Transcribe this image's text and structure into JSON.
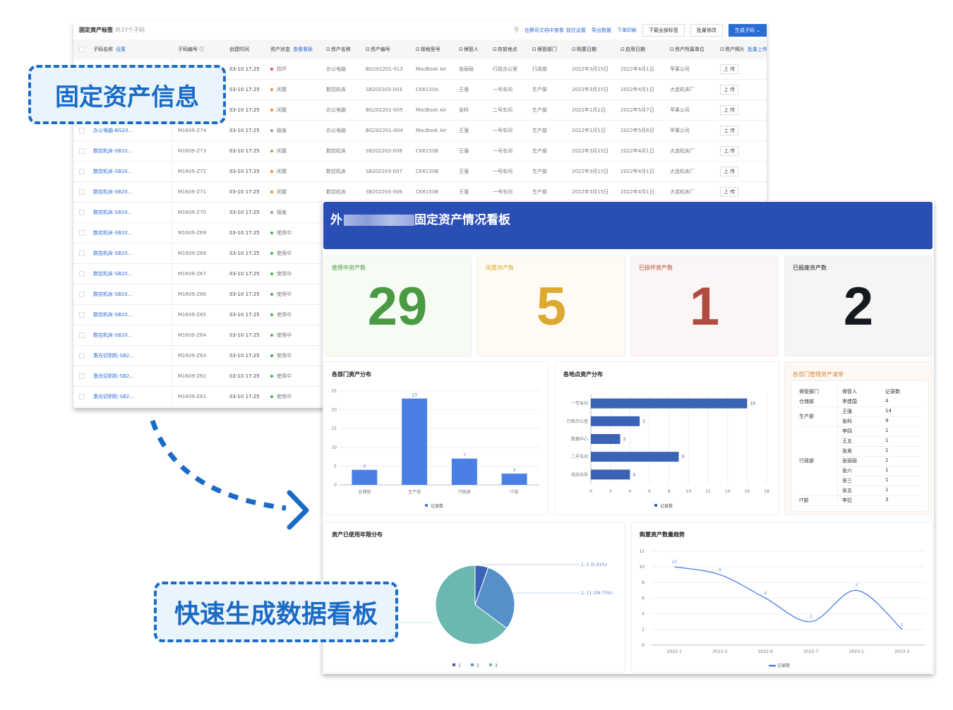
{
  "table": {
    "title": "固定资产标签",
    "count_text": "共37个子码",
    "actions": {
      "view_in_docs": "在腾讯文档中查看",
      "go_settings": "前往设置",
      "export": "导出数据",
      "print": "下单印刷",
      "download_all": "下载全部标签",
      "batch_edit": "批量修改",
      "generate": "生成子码"
    },
    "columns": [
      {
        "label": "子码名称",
        "link": "设置"
      },
      {
        "label": "子码编号 ⓘ"
      },
      {
        "label": "创建时间"
      },
      {
        "label": "资产状态",
        "link": "查看看板"
      },
      {
        "label": "资产名称"
      },
      {
        "label": "资产编号"
      },
      {
        "label": "规格型号"
      },
      {
        "label": "保管人"
      },
      {
        "label": "存放地点"
      },
      {
        "label": "保管部门"
      },
      {
        "label": "购置日期"
      },
      {
        "label": "启用日期"
      },
      {
        "label": "资产所属单位"
      },
      {
        "label": "资产照片",
        "link": "批量上传"
      }
    ],
    "upload_label": "上 传",
    "status_colors": {
      "损坏": "#e5484d",
      "闲置": "#f08a24",
      "报废": "#999999",
      "使用中": "#3cb44b"
    },
    "rows": [
      [
        "",
        "",
        "03-10 17:25",
        "损坏",
        "办公电脑",
        "BG202201-013",
        "MacBook Air",
        "张丽丽",
        "行政办公室",
        "行政部",
        "2022年3月15日",
        "2022年4月1日",
        "苹果公司"
      ],
      [
        "",
        "",
        "03-10 17:25",
        "闲置",
        "数控机床",
        "SB202203-003",
        "CK6150A",
        "王强",
        "一号车间",
        "生产部",
        "2022年3月15日",
        "2022年4月1日",
        "大连机床厂"
      ],
      [
        "",
        "",
        "03-10 17:25",
        "闲置",
        "办公电脑",
        "BG202201-005",
        "MacBook Air",
        "张科",
        "二号车间",
        "生产部",
        "2022年1月1日",
        "2022年5月7日",
        "苹果公司"
      ],
      [
        "办公电脑-BG20...",
        "M1609-Z74",
        "03-10 17:25",
        "报废",
        "办公电脑",
        "BG202201-004",
        "MacBook Air",
        "王强",
        "一号车间",
        "生产部",
        "2022年1月1日",
        "2022年5月6日",
        "苹果公司"
      ],
      [
        "数控机床-SB20...",
        "M1609-Z73",
        "03-10 17:25",
        "闲置",
        "数控机床",
        "SB202203-008",
        "CK6150B",
        "王强",
        "一号车间",
        "生产部",
        "2022年3月15日",
        "2022年4月1日",
        "大连机床厂"
      ],
      [
        "数控机床-SB20...",
        "M1609-Z72",
        "03-10 17:25",
        "闲置",
        "数控机床",
        "SB202203-007",
        "CK6150B",
        "王强",
        "一号车间",
        "生产部",
        "2022年3月15日",
        "2022年4月1日",
        "大连机床厂"
      ],
      [
        "数控机床-SB20...",
        "M1609-Z71",
        "03-10 17:25",
        "闲置",
        "数控机床",
        "SB202203-006",
        "CK6150B",
        "王强",
        "一号车间",
        "生产部",
        "2022年3月15日",
        "2022年4月1日",
        "大连机床厂"
      ],
      [
        "数控机床-SB20...",
        "M1609-Z70",
        "03-10 17:25",
        "报废"
      ],
      [
        "数控机床-SB20...",
        "M1609-Z69",
        "03-10 17:25",
        "使用中"
      ],
      [
        "数控机床-SB20...",
        "M1609-Z68",
        "03-10 17:25",
        "使用中"
      ],
      [
        "数控机床-SB20...",
        "M1609-Z67",
        "03-10 17:25",
        "使用中"
      ],
      [
        "数控机床-SB20...",
        "M1609-Z66",
        "03-10 17:25",
        "使用中"
      ],
      [
        "数控机床-SB20...",
        "M1609-Z65",
        "03-10 17:25",
        "使用中"
      ],
      [
        "数控机床-SB20...",
        "M1609-Z64",
        "03-10 17:25",
        "使用中"
      ],
      [
        "激光切割机-SB2...",
        "M1609-Z63",
        "03-10 17:25",
        "使用中"
      ],
      [
        "激光切割机-SB2...",
        "M1609-Z62",
        "03-10 17:25",
        "使用中"
      ],
      [
        "激光切割机-SB2...",
        "M1609-Z61",
        "03-10 17:25",
        "使用中"
      ]
    ],
    "upload_rows": 7
  },
  "dashboard": {
    "title_prefix": "外",
    "title": "固定资产情况看板",
    "banner_color": "#2a4fb4",
    "cards": [
      {
        "label": "使用中资产数",
        "value": "29",
        "color": "#4a9a44",
        "bg": "#f6fbf4"
      },
      {
        "label": "闲置资产数",
        "value": "5",
        "color": "#dcaa30",
        "bg": "#fffbf4"
      },
      {
        "label": "已损坏资产数",
        "value": "1",
        "color": "#b14a3f",
        "bg": "#fcf5f5"
      },
      {
        "label": "已报废资产数",
        "value": "2",
        "color": "#15181c",
        "bg": "#f5f5f5"
      }
    ],
    "manager_list": {
      "title": "各部门管理资产清单",
      "headers": [
        "保管部门",
        "保管人",
        "记录数"
      ],
      "groups": [
        {
          "dept": "仓储部",
          "rows": [
            [
              "李建国",
              "4"
            ]
          ]
        },
        {
          "dept": "生产部",
          "rows": [
            [
              "王强",
              "14"
            ],
            [
              "张科",
              "9"
            ]
          ]
        },
        {
          "dept": "行政部",
          "rows": [
            [
              "李四",
              "1"
            ],
            [
              "王五",
              "1"
            ],
            [
              "张发",
              "1"
            ],
            [
              "张丽丽",
              "1"
            ],
            [
              "张六",
              "1"
            ],
            [
              "张三",
              "1"
            ],
            [
              "张五",
              "1"
            ]
          ]
        },
        {
          "dept": "IT部",
          "rows": [
            [
              "李拉",
              "3"
            ]
          ]
        }
      ]
    }
  },
  "chart_data": [
    {
      "type": "bar",
      "title": "各部门资产分布",
      "categories": [
        "仓储部",
        "生产部",
        "行政部",
        "IT部"
      ],
      "series": [
        {
          "name": "记录数",
          "values": [
            4,
            23,
            7,
            3
          ]
        }
      ],
      "ylim": [
        0,
        25
      ],
      "yticks": [
        0,
        5,
        10,
        15,
        20,
        25
      ],
      "color": "#4a80e6",
      "grid": true,
      "legend": "bottom"
    },
    {
      "type": "bar",
      "orientation": "horizontal",
      "title": "各地点资产分布",
      "categories": [
        "一号车间",
        "行政办公室",
        "数据中心",
        "二号车间",
        "成品仓库"
      ],
      "series": [
        {
          "name": "记录数",
          "values": [
            16,
            5,
            3,
            9,
            4
          ]
        }
      ],
      "xlim": [
        0,
        18
      ],
      "xticks": [
        0,
        2,
        4,
        6,
        8,
        10,
        12,
        14,
        16,
        18
      ],
      "color": "#3a62b5",
      "grid": true,
      "legend": "bottom"
    },
    {
      "type": "pie",
      "title": "资产已使用年限分布",
      "categories": [
        "1",
        "2",
        "3"
      ],
      "values": [
        2,
        11,
        24
      ],
      "labels": [
        "1: 2 (5.41%)",
        "2: 11 (29.73%)"
      ],
      "colors": [
        "#3a62b5",
        "#5590c8",
        "#6bb8b0"
      ],
      "legend": "bottom"
    },
    {
      "type": "line",
      "title": "购置资产数量趋势",
      "x": [
        "2022-1",
        "2022-3",
        "2022-6",
        "2022-7",
        "2023-1",
        "2023-3"
      ],
      "series": [
        {
          "name": "记录数",
          "values": [
            10,
            9,
            6,
            3,
            7,
            2
          ]
        }
      ],
      "ylim": [
        0,
        12
      ],
      "yticks": [
        0,
        2,
        4,
        6,
        8,
        10,
        12
      ],
      "color": "#4a80e6",
      "smooth": true,
      "grid": true,
      "legend": "bottom"
    }
  ],
  "callouts": {
    "top": "固定资产信息",
    "bottom": "快速生成数据看板"
  }
}
